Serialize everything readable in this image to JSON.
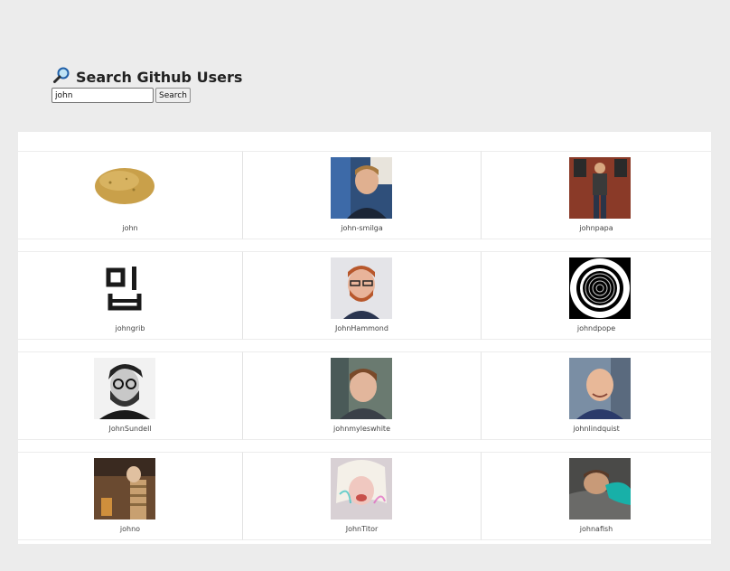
{
  "header": {
    "title": "Search Github Users",
    "icon": "magnifier-icon"
  },
  "search": {
    "value": "john",
    "button_label": "Search"
  },
  "users": [
    {
      "login": "john"
    },
    {
      "login": "john-smilga"
    },
    {
      "login": "johnpapa"
    },
    {
      "login": "johngrib"
    },
    {
      "login": "JohnHammond"
    },
    {
      "login": "johndpope"
    },
    {
      "login": "JohnSundell"
    },
    {
      "login": "johnmyleswhite"
    },
    {
      "login": "johnlindquist"
    },
    {
      "login": "johno"
    },
    {
      "login": "JohnTitor"
    },
    {
      "login": "johnafish"
    }
  ]
}
